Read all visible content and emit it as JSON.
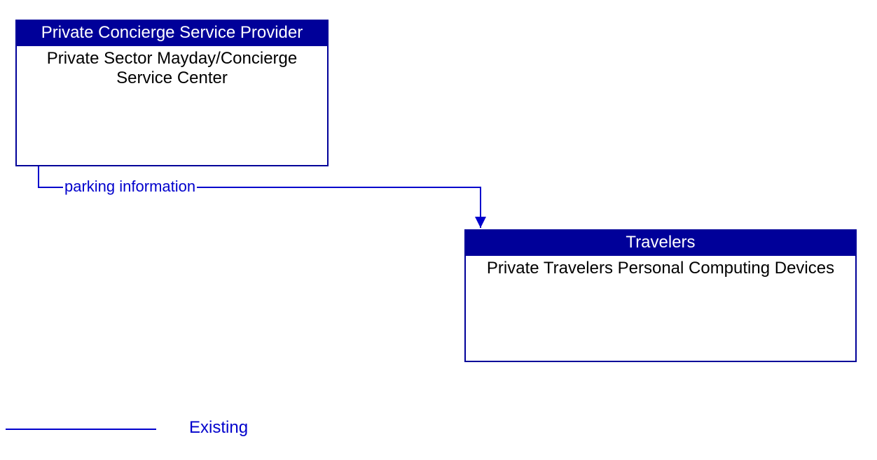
{
  "boxes": {
    "provider": {
      "header": "Private Concierge Service Provider",
      "body": "Private Sector Mayday/Concierge Service Center"
    },
    "travelers": {
      "header": "Travelers",
      "body": "Private Travelers Personal Computing Devices"
    }
  },
  "flow_label": "parking information",
  "legend": {
    "label": "Existing"
  },
  "colors": {
    "header_bg": "#000099",
    "line": "#0000cc"
  }
}
